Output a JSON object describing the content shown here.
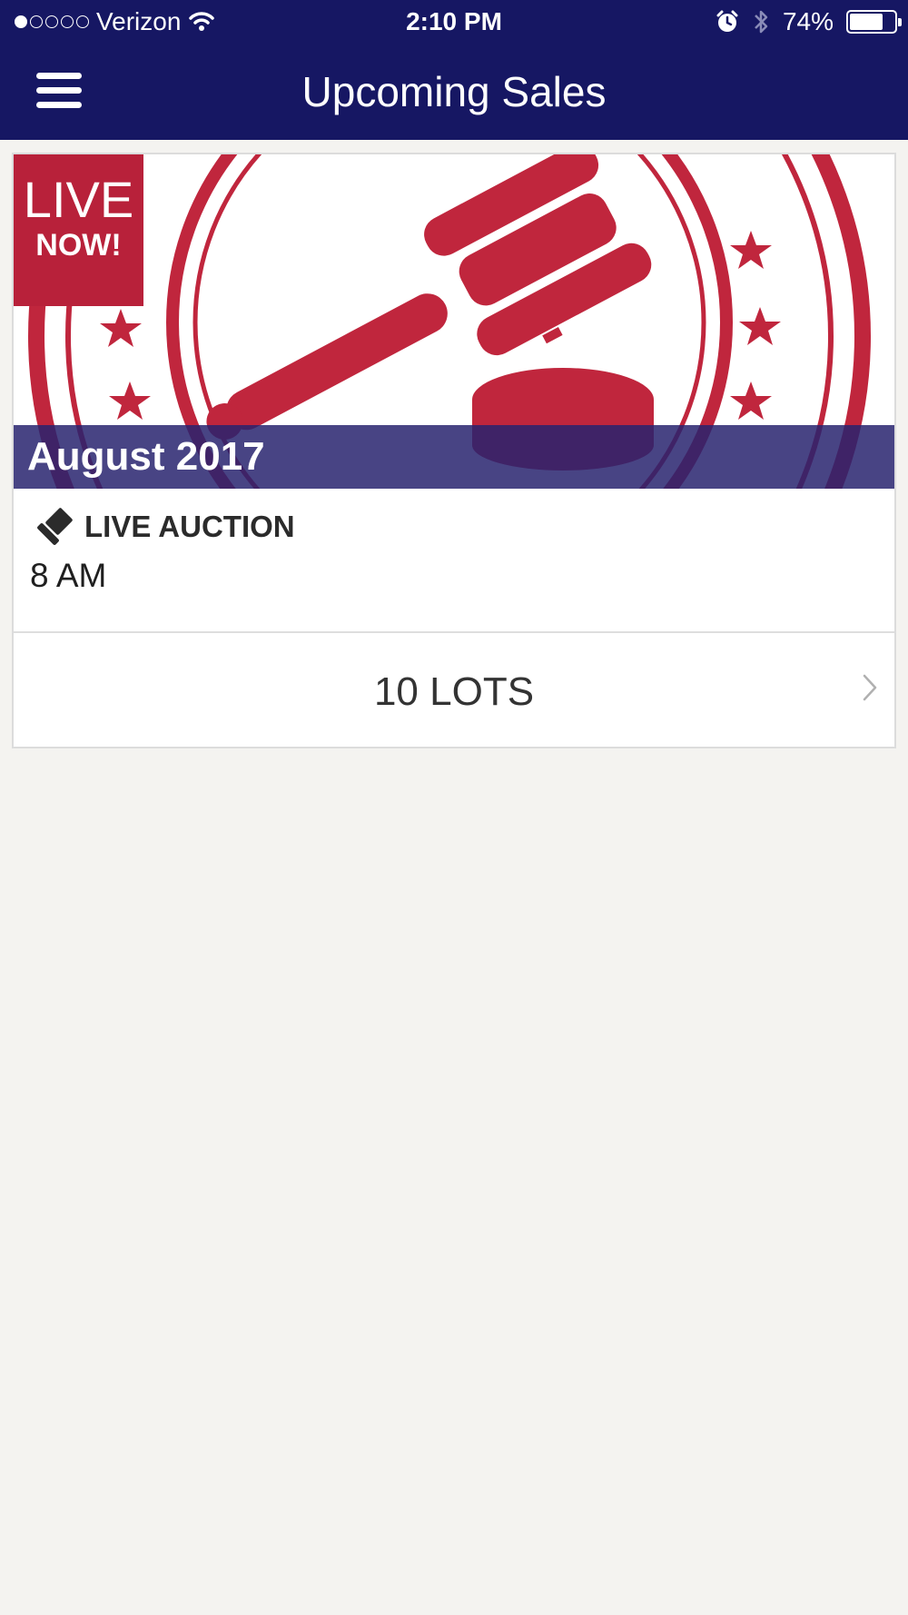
{
  "status_bar": {
    "carrier": "Verizon",
    "time": "2:10 PM",
    "battery": "74%",
    "battery_level": 0.74
  },
  "nav": {
    "title": "Upcoming Sales"
  },
  "sale": {
    "badge_line1": "LIVE",
    "badge_line2": "NOW!",
    "title": "August 2017",
    "type": "LIVE AUCTION",
    "time": "8 AM",
    "lots": "10 LOTS"
  },
  "colors": {
    "nav_background": "#161763",
    "badge_red": "#b8213a",
    "title_bar": "#28236e",
    "page_background": "#f4f3f0"
  },
  "icons": [
    "wifi-icon",
    "alarm-icon",
    "bluetooth-icon",
    "battery-icon",
    "menu-icon",
    "gavel-icon",
    "chevron-right-icon"
  ]
}
